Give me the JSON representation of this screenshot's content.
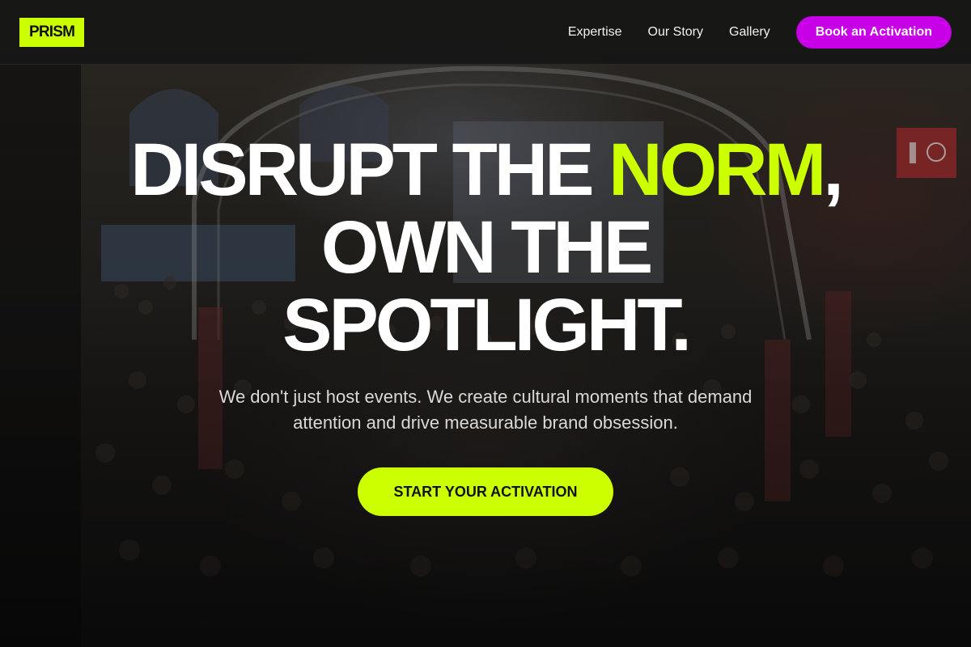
{
  "brand": {
    "logo_text": "PRISM",
    "accent_color": "#ccff00",
    "cta_color": "#c800e8"
  },
  "nav": {
    "links": [
      "Expertise",
      "Our Story",
      "Gallery"
    ],
    "cta_label": "Book an Activation"
  },
  "hero": {
    "headline": {
      "part1": "DISRUPT THE ",
      "highlight": "NORM",
      "part2": ",",
      "line2": "OWN THE",
      "line3": "SPOTLIGHT."
    },
    "subtext": "We don't just host events. We create cultural moments that demand attention and drive measurable brand obsession.",
    "cta_label": "START YOUR ACTIVATION",
    "background_image": "event-crowd-photo"
  }
}
